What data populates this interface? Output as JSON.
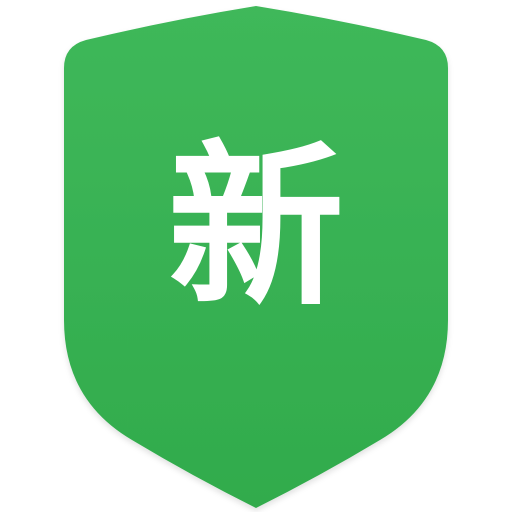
{
  "badge": {
    "character": "新",
    "colors": {
      "shield_top": "#3fb85a",
      "shield_bottom": "#31ab4c",
      "text": "#ffffff",
      "background": "#ffffff"
    },
    "icon_name": "shield-badge-icon"
  }
}
